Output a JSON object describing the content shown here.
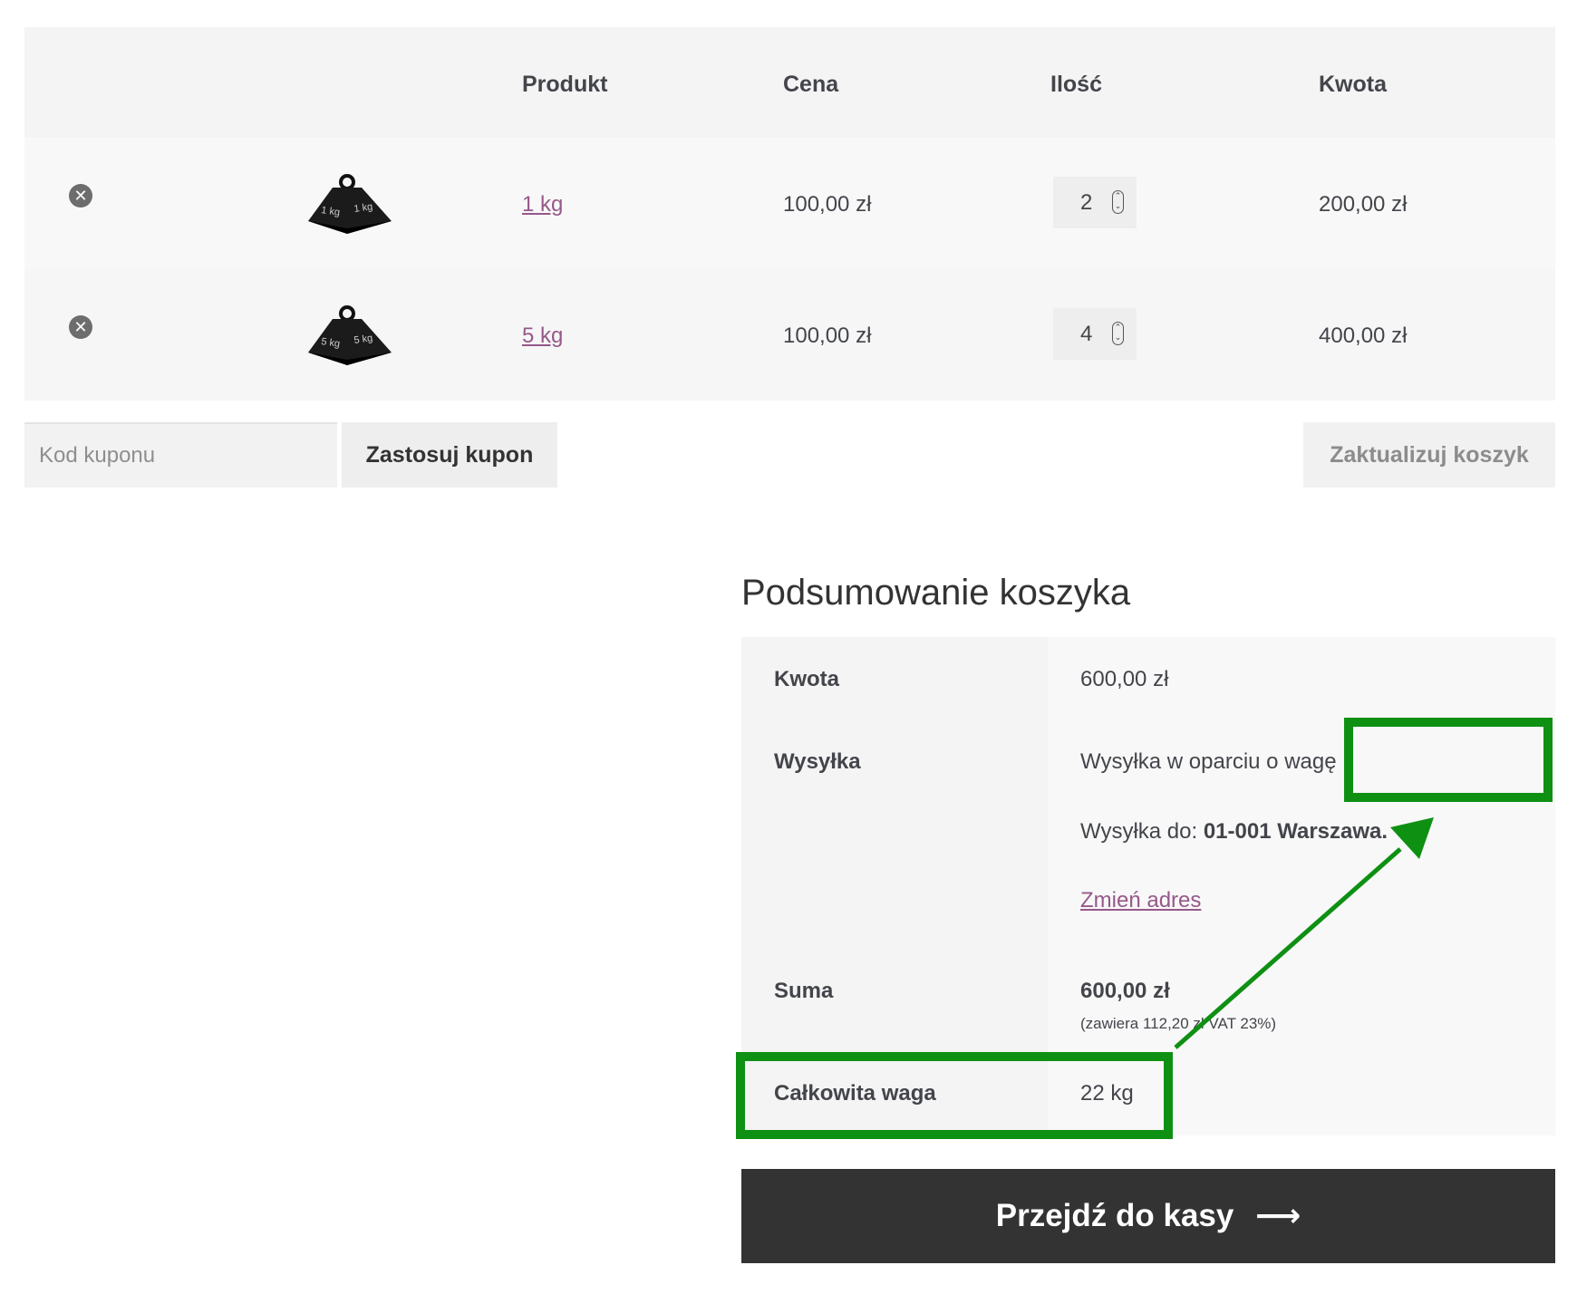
{
  "cart": {
    "headers": {
      "remove": "",
      "thumbnail": "",
      "product": "Produkt",
      "price": "Cena",
      "quantity": "Ilość",
      "subtotal": "Kwota"
    },
    "rows": [
      {
        "product": "1 kg",
        "thumb_label": "1 kg",
        "price": "100,00 zł",
        "quantity": "2",
        "subtotal": "200,00 zł"
      },
      {
        "product": "5 kg",
        "thumb_label": "5 kg",
        "price": "100,00 zł",
        "quantity": "4",
        "subtotal": "400,00 zł"
      }
    ]
  },
  "coupon": {
    "placeholder": "Kod kuponu",
    "apply_label": "Zastosuj kupon"
  },
  "update_cart_label": "Zaktualizuj koszyk",
  "totals": {
    "title": "Podsumowanie koszyka",
    "subtotal_label": "Kwota",
    "subtotal_value": "600,00 zł",
    "shipping_label": "Wysyłka",
    "shipping_method": "Wysyłka w oparciu o wagę",
    "shipping_to_prefix": "Wysyłka do:",
    "shipping_to_address": "01-001 Warszawa.",
    "change_address": "Zmień adres",
    "total_label": "Suma",
    "total_value": "600,00 zł",
    "tax_note": "(zawiera 112,20 zł VAT 23%)",
    "weight_label": "Całkowita waga",
    "weight_value": "22 kg"
  },
  "checkout": {
    "label": "Przejdź do kasy",
    "arrow": "⟶"
  },
  "colors": {
    "link": "#96588a",
    "checkout_bg": "#333333",
    "annotation": "#0e9013"
  }
}
